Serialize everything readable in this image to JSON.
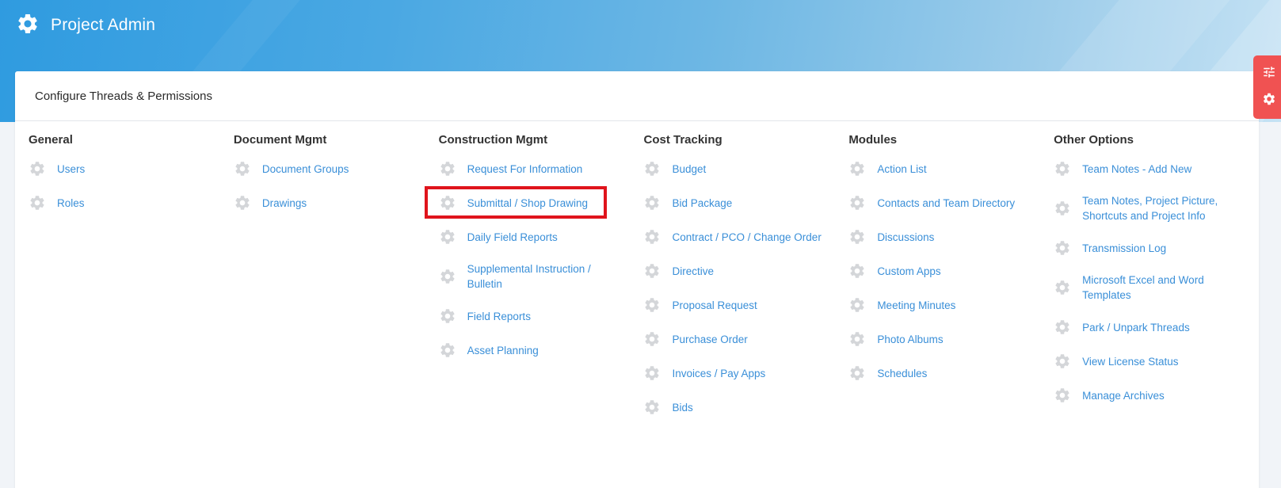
{
  "app": {
    "title": "Project Admin",
    "accent": "#3a8fd8",
    "banner_color": "#2f9be0"
  },
  "card": {
    "title": "Configure Threads & Permissions"
  },
  "columns": [
    {
      "title": "General",
      "items": [
        {
          "label": "Users"
        },
        {
          "label": "Roles"
        }
      ]
    },
    {
      "title": "Document Mgmt",
      "items": [
        {
          "label": "Document Groups"
        },
        {
          "label": "Drawings"
        }
      ]
    },
    {
      "title": "Construction Mgmt",
      "items": [
        {
          "label": "Request For Information"
        },
        {
          "label": "Submittal / Shop Drawing",
          "highlighted": true
        },
        {
          "label": "Daily Field Reports"
        },
        {
          "label": "Supplemental Instruction / Bulletin"
        },
        {
          "label": "Field Reports"
        },
        {
          "label": "Asset Planning"
        }
      ]
    },
    {
      "title": "Cost Tracking",
      "items": [
        {
          "label": "Budget"
        },
        {
          "label": "Bid Package"
        },
        {
          "label": "Contract / PCO / Change Order"
        },
        {
          "label": "Directive"
        },
        {
          "label": "Proposal Request"
        },
        {
          "label": "Purchase Order"
        },
        {
          "label": "Invoices / Pay Apps"
        },
        {
          "label": "Bids"
        }
      ]
    },
    {
      "title": "Modules",
      "items": [
        {
          "label": "Action List"
        },
        {
          "label": "Contacts and Team Directory"
        },
        {
          "label": "Discussions"
        },
        {
          "label": "Custom Apps"
        },
        {
          "label": "Meeting Minutes"
        },
        {
          "label": "Photo Albums"
        },
        {
          "label": "Schedules"
        }
      ]
    },
    {
      "title": "Other Options",
      "items": [
        {
          "label": "Team Notes - Add New"
        },
        {
          "label": "Team Notes, Project Picture, Shortcuts and Project Info"
        },
        {
          "label": "Transmission Log"
        },
        {
          "label": "Microsoft Excel and Word Templates"
        },
        {
          "label": "Park / Unpark Threads"
        },
        {
          "label": "View License Status"
        },
        {
          "label": "Manage Archives"
        }
      ]
    }
  ],
  "side_widget": {
    "icons": [
      "sliders-icon",
      "gear-icon"
    ],
    "color": "#f05252"
  }
}
